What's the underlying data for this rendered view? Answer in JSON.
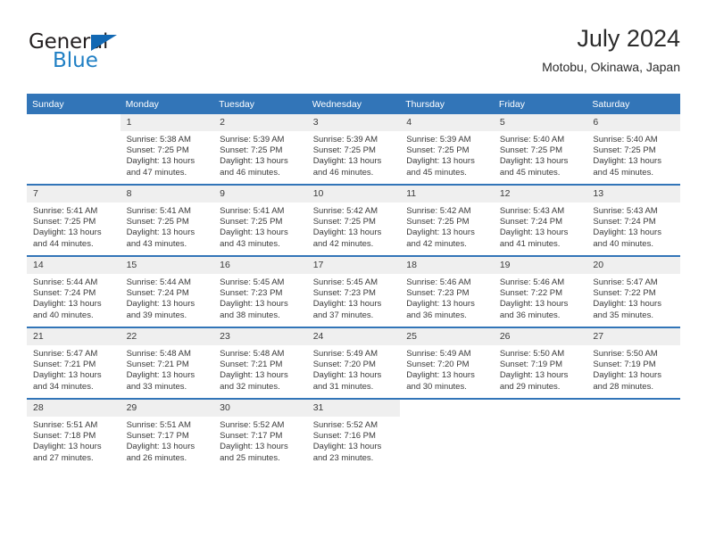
{
  "brand": {
    "name_part1": "General",
    "name_part2": "Blue",
    "triangle_color": "#1268b3",
    "blue_color": "#1f7fc4"
  },
  "header": {
    "title": "July 2024",
    "subtitle": "Motobu, Okinawa, Japan"
  },
  "theme": {
    "header_bg": "#3275b8",
    "daynum_bg": "#efefef",
    "text": "#3a3a3a"
  },
  "weekday_headers": [
    "Sunday",
    "Monday",
    "Tuesday",
    "Wednesday",
    "Thursday",
    "Friday",
    "Saturday"
  ],
  "weeks": [
    [
      {
        "day": "",
        "sunrise": "",
        "sunset": "",
        "daylight_line1": "",
        "daylight_line2": "",
        "blank": true
      },
      {
        "day": "1",
        "sunrise": "Sunrise: 5:38 AM",
        "sunset": "Sunset: 7:25 PM",
        "daylight_line1": "Daylight: 13 hours",
        "daylight_line2": "and 47 minutes."
      },
      {
        "day": "2",
        "sunrise": "Sunrise: 5:39 AM",
        "sunset": "Sunset: 7:25 PM",
        "daylight_line1": "Daylight: 13 hours",
        "daylight_line2": "and 46 minutes."
      },
      {
        "day": "3",
        "sunrise": "Sunrise: 5:39 AM",
        "sunset": "Sunset: 7:25 PM",
        "daylight_line1": "Daylight: 13 hours",
        "daylight_line2": "and 46 minutes."
      },
      {
        "day": "4",
        "sunrise": "Sunrise: 5:39 AM",
        "sunset": "Sunset: 7:25 PM",
        "daylight_line1": "Daylight: 13 hours",
        "daylight_line2": "and 45 minutes."
      },
      {
        "day": "5",
        "sunrise": "Sunrise: 5:40 AM",
        "sunset": "Sunset: 7:25 PM",
        "daylight_line1": "Daylight: 13 hours",
        "daylight_line2": "and 45 minutes."
      },
      {
        "day": "6",
        "sunrise": "Sunrise: 5:40 AM",
        "sunset": "Sunset: 7:25 PM",
        "daylight_line1": "Daylight: 13 hours",
        "daylight_line2": "and 45 minutes."
      }
    ],
    [
      {
        "day": "7",
        "sunrise": "Sunrise: 5:41 AM",
        "sunset": "Sunset: 7:25 PM",
        "daylight_line1": "Daylight: 13 hours",
        "daylight_line2": "and 44 minutes."
      },
      {
        "day": "8",
        "sunrise": "Sunrise: 5:41 AM",
        "sunset": "Sunset: 7:25 PM",
        "daylight_line1": "Daylight: 13 hours",
        "daylight_line2": "and 43 minutes."
      },
      {
        "day": "9",
        "sunrise": "Sunrise: 5:41 AM",
        "sunset": "Sunset: 7:25 PM",
        "daylight_line1": "Daylight: 13 hours",
        "daylight_line2": "and 43 minutes."
      },
      {
        "day": "10",
        "sunrise": "Sunrise: 5:42 AM",
        "sunset": "Sunset: 7:25 PM",
        "daylight_line1": "Daylight: 13 hours",
        "daylight_line2": "and 42 minutes."
      },
      {
        "day": "11",
        "sunrise": "Sunrise: 5:42 AM",
        "sunset": "Sunset: 7:25 PM",
        "daylight_line1": "Daylight: 13 hours",
        "daylight_line2": "and 42 minutes."
      },
      {
        "day": "12",
        "sunrise": "Sunrise: 5:43 AM",
        "sunset": "Sunset: 7:24 PM",
        "daylight_line1": "Daylight: 13 hours",
        "daylight_line2": "and 41 minutes."
      },
      {
        "day": "13",
        "sunrise": "Sunrise: 5:43 AM",
        "sunset": "Sunset: 7:24 PM",
        "daylight_line1": "Daylight: 13 hours",
        "daylight_line2": "and 40 minutes."
      }
    ],
    [
      {
        "day": "14",
        "sunrise": "Sunrise: 5:44 AM",
        "sunset": "Sunset: 7:24 PM",
        "daylight_line1": "Daylight: 13 hours",
        "daylight_line2": "and 40 minutes."
      },
      {
        "day": "15",
        "sunrise": "Sunrise: 5:44 AM",
        "sunset": "Sunset: 7:24 PM",
        "daylight_line1": "Daylight: 13 hours",
        "daylight_line2": "and 39 minutes."
      },
      {
        "day": "16",
        "sunrise": "Sunrise: 5:45 AM",
        "sunset": "Sunset: 7:23 PM",
        "daylight_line1": "Daylight: 13 hours",
        "daylight_line2": "and 38 minutes."
      },
      {
        "day": "17",
        "sunrise": "Sunrise: 5:45 AM",
        "sunset": "Sunset: 7:23 PM",
        "daylight_line1": "Daylight: 13 hours",
        "daylight_line2": "and 37 minutes."
      },
      {
        "day": "18",
        "sunrise": "Sunrise: 5:46 AM",
        "sunset": "Sunset: 7:23 PM",
        "daylight_line1": "Daylight: 13 hours",
        "daylight_line2": "and 36 minutes."
      },
      {
        "day": "19",
        "sunrise": "Sunrise: 5:46 AM",
        "sunset": "Sunset: 7:22 PM",
        "daylight_line1": "Daylight: 13 hours",
        "daylight_line2": "and 36 minutes."
      },
      {
        "day": "20",
        "sunrise": "Sunrise: 5:47 AM",
        "sunset": "Sunset: 7:22 PM",
        "daylight_line1": "Daylight: 13 hours",
        "daylight_line2": "and 35 minutes."
      }
    ],
    [
      {
        "day": "21",
        "sunrise": "Sunrise: 5:47 AM",
        "sunset": "Sunset: 7:21 PM",
        "daylight_line1": "Daylight: 13 hours",
        "daylight_line2": "and 34 minutes."
      },
      {
        "day": "22",
        "sunrise": "Sunrise: 5:48 AM",
        "sunset": "Sunset: 7:21 PM",
        "daylight_line1": "Daylight: 13 hours",
        "daylight_line2": "and 33 minutes."
      },
      {
        "day": "23",
        "sunrise": "Sunrise: 5:48 AM",
        "sunset": "Sunset: 7:21 PM",
        "daylight_line1": "Daylight: 13 hours",
        "daylight_line2": "and 32 minutes."
      },
      {
        "day": "24",
        "sunrise": "Sunrise: 5:49 AM",
        "sunset": "Sunset: 7:20 PM",
        "daylight_line1": "Daylight: 13 hours",
        "daylight_line2": "and 31 minutes."
      },
      {
        "day": "25",
        "sunrise": "Sunrise: 5:49 AM",
        "sunset": "Sunset: 7:20 PM",
        "daylight_line1": "Daylight: 13 hours",
        "daylight_line2": "and 30 minutes."
      },
      {
        "day": "26",
        "sunrise": "Sunrise: 5:50 AM",
        "sunset": "Sunset: 7:19 PM",
        "daylight_line1": "Daylight: 13 hours",
        "daylight_line2": "and 29 minutes."
      },
      {
        "day": "27",
        "sunrise": "Sunrise: 5:50 AM",
        "sunset": "Sunset: 7:19 PM",
        "daylight_line1": "Daylight: 13 hours",
        "daylight_line2": "and 28 minutes."
      }
    ],
    [
      {
        "day": "28",
        "sunrise": "Sunrise: 5:51 AM",
        "sunset": "Sunset: 7:18 PM",
        "daylight_line1": "Daylight: 13 hours",
        "daylight_line2": "and 27 minutes."
      },
      {
        "day": "29",
        "sunrise": "Sunrise: 5:51 AM",
        "sunset": "Sunset: 7:17 PM",
        "daylight_line1": "Daylight: 13 hours",
        "daylight_line2": "and 26 minutes."
      },
      {
        "day": "30",
        "sunrise": "Sunrise: 5:52 AM",
        "sunset": "Sunset: 7:17 PM",
        "daylight_line1": "Daylight: 13 hours",
        "daylight_line2": "and 25 minutes."
      },
      {
        "day": "31",
        "sunrise": "Sunrise: 5:52 AM",
        "sunset": "Sunset: 7:16 PM",
        "daylight_line1": "Daylight: 13 hours",
        "daylight_line2": "and 23 minutes."
      },
      {
        "day": "",
        "sunrise": "",
        "sunset": "",
        "daylight_line1": "",
        "daylight_line2": "",
        "blank": true
      },
      {
        "day": "",
        "sunrise": "",
        "sunset": "",
        "daylight_line1": "",
        "daylight_line2": "",
        "blank": true
      },
      {
        "day": "",
        "sunrise": "",
        "sunset": "",
        "daylight_line1": "",
        "daylight_line2": "",
        "blank": true
      }
    ]
  ]
}
